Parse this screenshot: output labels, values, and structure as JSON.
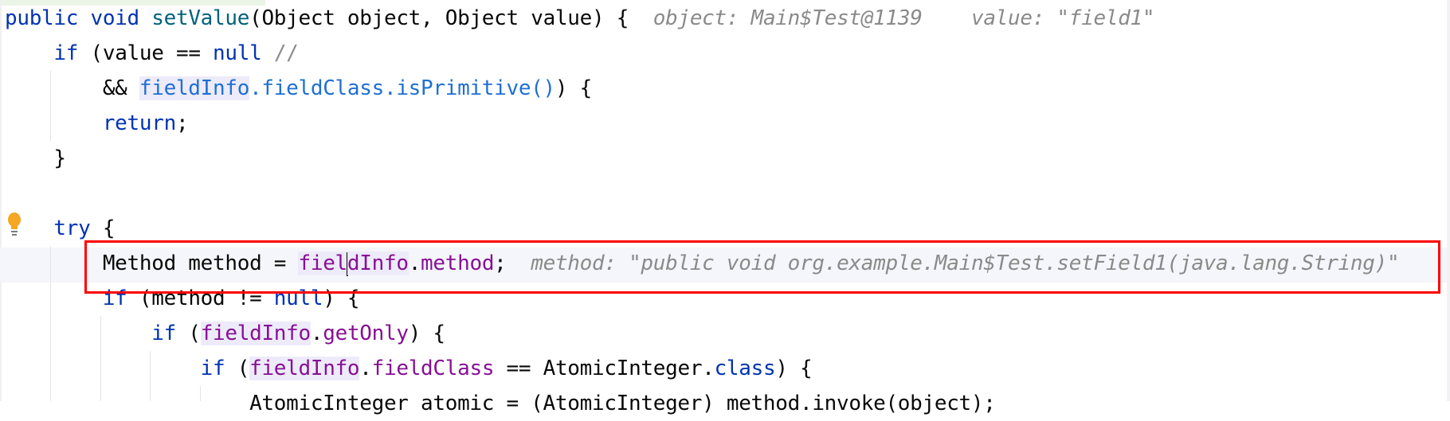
{
  "editor": {
    "language": "Java",
    "colors": {
      "keyword": "#0033b3",
      "method": "#00627a",
      "field": "#871094",
      "link": "#1f6fd4",
      "comment": "#8c8c8c",
      "hint": "#8a8a8a",
      "annotation_box": "#ff0000",
      "current_line": "#f5f6fb"
    },
    "current_line_index": 7,
    "gutter_icon": "lightbulb-icon",
    "lines": [
      {
        "tokens": [
          {
            "t": "public",
            "c": "kw"
          },
          {
            "t": " "
          },
          {
            "t": "void",
            "c": "kw"
          },
          {
            "t": " "
          },
          {
            "t": "setValue",
            "c": "fn"
          },
          {
            "t": "(Object object, Object value) {"
          },
          {
            "t": "  object: Main$Test@1139",
            "c": "hint"
          },
          {
            "t": "    value: \"field1\"",
            "c": "hint"
          }
        ]
      },
      {
        "tokens": [
          {
            "t": "    "
          },
          {
            "t": "if",
            "c": "kw"
          },
          {
            "t": " (value == "
          },
          {
            "t": "null",
            "c": "kw"
          },
          {
            "t": " "
          },
          {
            "t": "//",
            "c": "cm"
          }
        ]
      },
      {
        "tokens": [
          {
            "t": "        && "
          },
          {
            "t": "fieldInfo",
            "c": "link hl"
          },
          {
            "t": ".fieldClass.isPrimitive()",
            "c": "link"
          },
          {
            "t": ") {"
          }
        ]
      },
      {
        "tokens": [
          {
            "t": "        "
          },
          {
            "t": "return",
            "c": "kw"
          },
          {
            "t": ";"
          }
        ]
      },
      {
        "tokens": [
          {
            "t": "    }"
          }
        ]
      },
      {
        "tokens": [
          {
            "t": ""
          }
        ]
      },
      {
        "tokens": [
          {
            "t": "    "
          },
          {
            "t": "try",
            "c": "kw"
          },
          {
            "t": " {"
          }
        ]
      },
      {
        "tokens": [
          {
            "t": "        Method method = "
          },
          {
            "t": "fiel",
            "c": "fld hl"
          },
          {
            "t": "",
            "c": "caret"
          },
          {
            "t": "dInfo",
            "c": "fld hl"
          },
          {
            "t": "."
          },
          {
            "t": "method",
            "c": "fld"
          },
          {
            "t": ";"
          },
          {
            "t": "  method: \"public void org.example.Main$Test.setField1(java.lang.String)\"",
            "c": "hint"
          }
        ]
      },
      {
        "tokens": [
          {
            "t": "        "
          },
          {
            "t": "if",
            "c": "kw"
          },
          {
            "t": " (method != "
          },
          {
            "t": "null",
            "c": "kw"
          },
          {
            "t": ") {"
          }
        ]
      },
      {
        "tokens": [
          {
            "t": "            "
          },
          {
            "t": "if",
            "c": "kw"
          },
          {
            "t": " ("
          },
          {
            "t": "fieldInfo",
            "c": "fld hl"
          },
          {
            "t": "."
          },
          {
            "t": "getOnly",
            "c": "fld"
          },
          {
            "t": ") {"
          }
        ]
      },
      {
        "tokens": [
          {
            "t": "                "
          },
          {
            "t": "if",
            "c": "kw"
          },
          {
            "t": " ("
          },
          {
            "t": "fieldInfo",
            "c": "fld hl"
          },
          {
            "t": "."
          },
          {
            "t": "fieldClass",
            "c": "fld"
          },
          {
            "t": " == AtomicInteger."
          },
          {
            "t": "class",
            "c": "kw"
          },
          {
            "t": ") {"
          }
        ]
      },
      {
        "tokens": [
          {
            "t": "                    AtomicInteger atomic = (AtomicInteger) method.invoke(object);"
          }
        ]
      }
    ]
  }
}
